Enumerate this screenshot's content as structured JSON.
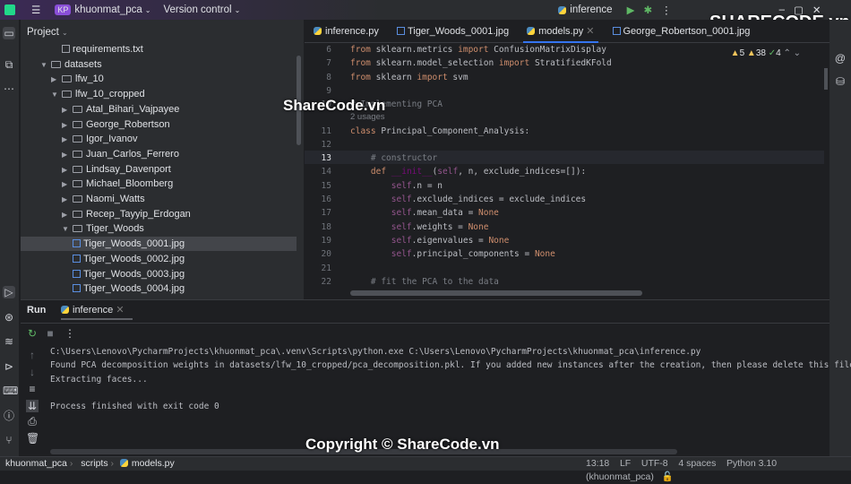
{
  "titlebar": {
    "project_badge": "KP",
    "project": "khuonmat_pca",
    "vcs": "Version control",
    "run_config": "inference"
  },
  "project_panel": {
    "title": "Project",
    "items": [
      {
        "label": "requirements.txt",
        "type": "file",
        "indent": 3
      },
      {
        "label": "datasets",
        "type": "folder",
        "indent": 1,
        "open": true
      },
      {
        "label": "lfw_10",
        "type": "folder",
        "indent": 2
      },
      {
        "label": "lfw_10_cropped",
        "type": "folder",
        "indent": 2,
        "open": true
      },
      {
        "label": "Atal_Bihari_Vajpayee",
        "type": "folder",
        "indent": 3
      },
      {
        "label": "George_Robertson",
        "type": "folder",
        "indent": 3
      },
      {
        "label": "Igor_Ivanov",
        "type": "folder",
        "indent": 3
      },
      {
        "label": "Juan_Carlos_Ferrero",
        "type": "folder",
        "indent": 3
      },
      {
        "label": "Lindsay_Davenport",
        "type": "folder",
        "indent": 3
      },
      {
        "label": "Michael_Bloomberg",
        "type": "folder",
        "indent": 3
      },
      {
        "label": "Naomi_Watts",
        "type": "folder",
        "indent": 3
      },
      {
        "label": "Recep_Tayyip_Erdogan",
        "type": "folder",
        "indent": 3
      },
      {
        "label": "Tiger_Woods",
        "type": "folder",
        "indent": 3,
        "open": true
      },
      {
        "label": "Tiger_Woods_0001.jpg",
        "type": "image",
        "indent": 4,
        "selected": true
      },
      {
        "label": "Tiger_Woods_0002.jpg",
        "type": "image",
        "indent": 4
      },
      {
        "label": "Tiger_Woods_0003.jpg",
        "type": "image",
        "indent": 4
      },
      {
        "label": "Tiger_Woods_0004.jpg",
        "type": "image",
        "indent": 4
      }
    ]
  },
  "editor": {
    "tabs": [
      {
        "label": "inference.py",
        "type": "py"
      },
      {
        "label": "Tiger_Woods_0001.jpg",
        "type": "image"
      },
      {
        "label": "models.py",
        "type": "py",
        "active": true
      },
      {
        "label": "George_Robertson_0001.jpg",
        "type": "image"
      }
    ],
    "inspections": {
      "errors": "5",
      "warnings": "38",
      "ok": "4"
    },
    "usages_label": "2 usages",
    "lines": [
      {
        "n": "6",
        "html": "<span class='kw'>from</span> sklearn.metrics <span class='kw'>import</span> ConfusionMatrixDisplay"
      },
      {
        "n": "7",
        "html": "<span class='kw'>from</span> sklearn.model_selection <span class='kw'>import</span> StratifiedKFold"
      },
      {
        "n": "8",
        "html": "<span class='kw'>from</span> sklearn <span class='kw'>import</span> svm"
      },
      {
        "n": "9",
        "html": ""
      },
      {
        "n": "10",
        "html": "<span class='cm'># Implementing PCA</span>"
      },
      {
        "n": "11",
        "html": "<span class='kw'>class</span> Principal_Component_Analysis:"
      },
      {
        "n": "12",
        "html": ""
      },
      {
        "n": "13",
        "html": "    <span class='cm'># constructor</span>"
      },
      {
        "n": "14",
        "html": "    <span class='kw'>def</span> <span class='fn'>__init__</span>(<span class='sf'>self</span>, n, exclude_indices=[]):"
      },
      {
        "n": "15",
        "html": "        <span class='sf'>self</span>.n = n"
      },
      {
        "n": "16",
        "html": "        <span class='sf'>self</span>.exclude_indices = exclude_indices"
      },
      {
        "n": "17",
        "html": "        <span class='sf'>self</span>.mean_data = <span class='kw'>None</span>"
      },
      {
        "n": "18",
        "html": "        <span class='sf'>self</span>.weights = <span class='kw'>None</span>"
      },
      {
        "n": "19",
        "html": "        <span class='sf'>self</span>.eigenvalues = <span class='kw'>None</span>"
      },
      {
        "n": "20",
        "html": "        <span class='sf'>self</span>.principal_components = <span class='kw'>None</span>"
      },
      {
        "n": "21",
        "html": ""
      },
      {
        "n": "22",
        "html": "    <span class='cm'># fit the PCA to the data</span>"
      }
    ]
  },
  "run": {
    "title": "Run",
    "tab": "inference",
    "output": [
      "C:\\Users\\Lenovo\\PycharmProjects\\khuonmat_pca\\.venv\\Scripts\\python.exe C:\\Users\\Lenovo\\PycharmProjects\\khuonmat_pca\\inference.py",
      "Found PCA decomposition weights in datasets/lfw_10_cropped/pca_decomposition.pkl. If you added new instances after the creation, then please delete this file",
      "Extracting faces...",
      "",
      "Process finished with exit code 0"
    ]
  },
  "status": {
    "breadcrumb": [
      "khuonmat_pca",
      "scripts",
      "models.py"
    ],
    "position": "13:18",
    "line_sep": "LF",
    "encoding": "UTF-8",
    "indent": "4 spaces",
    "interpreter": "Python 3.10 (khuonmat_pca)"
  },
  "watermarks": {
    "top": "SHARECODE.vn",
    "mid": "ShareCode.vn",
    "bottom": "Copyright © ShareCode.vn"
  }
}
